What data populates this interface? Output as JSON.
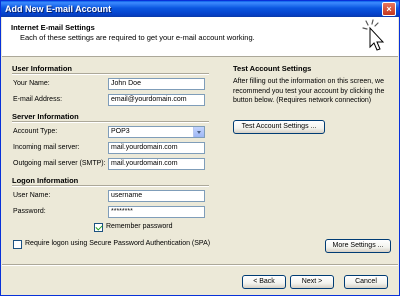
{
  "window": {
    "title": "Add New E-mail Account",
    "close_glyph": "×"
  },
  "header": {
    "title": "Internet E-mail Settings",
    "subtitle": "Each of these settings are required to get your e-mail account working."
  },
  "user_info": {
    "section": "User Information",
    "name_label": "Your Name:",
    "name_value": "John Doe",
    "email_label": "E-mail Address:",
    "email_value": "email@yourdomain.com"
  },
  "server_info": {
    "section": "Server Information",
    "account_type_label": "Account Type:",
    "account_type_value": "POP3",
    "incoming_label": "Incoming mail server:",
    "incoming_value": "mail.yourdomain.com",
    "outgoing_label": "Outgoing mail server (SMTP):",
    "outgoing_value": "mail.yourdomain.com"
  },
  "logon_info": {
    "section": "Logon Information",
    "username_label": "User Name:",
    "username_value": "username",
    "password_label": "Password:",
    "password_value": "********",
    "remember_label": "Remember password",
    "remember_checked": true,
    "spa_label": "Require logon using Secure Password Authentication (SPA)",
    "spa_checked": false
  },
  "test_settings": {
    "section": "Test Account Settings",
    "description": "After filling out the information on this screen, we recommend you test your account by clicking the button below. (Requires network connection)",
    "test_button": "Test Account Settings ..."
  },
  "more_settings_button": "More Settings ...",
  "footer": {
    "back": "< Back",
    "next": "Next >",
    "cancel": "Cancel"
  }
}
